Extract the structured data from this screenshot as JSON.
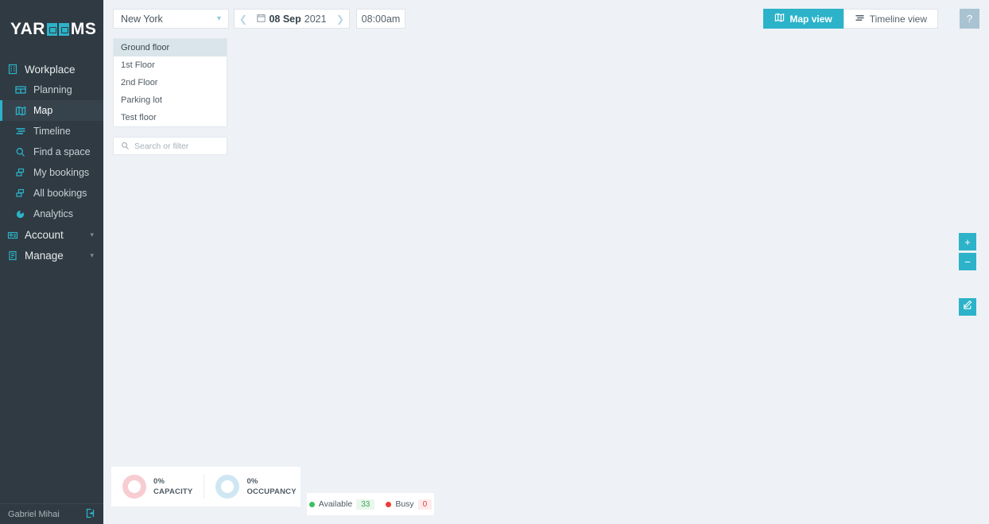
{
  "brand": {
    "name_part1": "YAR",
    "name_part2": "MS",
    "icon": "yarooms-logo"
  },
  "sidebar": {
    "groups": [
      {
        "label": "Workplace",
        "icon": "building-icon",
        "expandable": false,
        "items": [
          {
            "label": "Planning",
            "icon": "grid-icon",
            "active": false
          },
          {
            "label": "Map",
            "icon": "map-icon",
            "active": true
          },
          {
            "label": "Timeline",
            "icon": "timeline-icon",
            "active": false
          },
          {
            "label": "Find a space",
            "icon": "search-icon",
            "active": false
          },
          {
            "label": "My bookings",
            "icon": "bookings-icon",
            "active": false
          },
          {
            "label": "All bookings",
            "icon": "bookings-icon",
            "active": false
          },
          {
            "label": "Analytics",
            "icon": "pie-chart-icon",
            "active": false
          }
        ]
      },
      {
        "label": "Account",
        "icon": "account-icon",
        "expandable": true,
        "items": []
      },
      {
        "label": "Manage",
        "icon": "manage-icon",
        "expandable": true,
        "items": []
      }
    ],
    "user": {
      "name": "Gabriel Mihai",
      "logout_icon": "logout-icon"
    }
  },
  "toolbar": {
    "site": {
      "value": "New York",
      "chevron_icon": "chevron-down-icon"
    },
    "date": {
      "prev_icon": "chevron-left-icon",
      "next_icon": "chevron-right-icon",
      "calendar_icon": "calendar-icon",
      "day_month": "08 Sep",
      "year": "2021"
    },
    "time": {
      "value": "08:00am"
    },
    "views": [
      {
        "label": "Map view",
        "icon": "map-icon",
        "active": true
      },
      {
        "label": "Timeline view",
        "icon": "timeline-icon",
        "active": false
      }
    ],
    "help": {
      "label": "?",
      "icon": "help-icon"
    }
  },
  "floors": {
    "items": [
      {
        "label": "Ground floor",
        "selected": true
      },
      {
        "label": "1st Floor",
        "selected": false
      },
      {
        "label": "2nd Floor",
        "selected": false
      },
      {
        "label": "Parking lot",
        "selected": false
      },
      {
        "label": "Test floor",
        "selected": false
      }
    ]
  },
  "search": {
    "placeholder": "Search or filter",
    "icon": "search-icon"
  },
  "map_controls": {
    "zoom_in": {
      "label": "+",
      "icon": "plus-icon"
    },
    "zoom_out": {
      "label": "−",
      "icon": "minus-icon"
    },
    "edit": {
      "icon": "edit-pencil-icon"
    }
  },
  "stats": {
    "capacity": {
      "value": "0%",
      "label": "CAPACITY",
      "color": "#f7cdd2"
    },
    "occupancy": {
      "value": "0%",
      "label": "OCCUPANCY",
      "color": "#cfe7f2"
    }
  },
  "legend": {
    "available": {
      "label": "Available",
      "count": "33",
      "color": "#3fc063"
    },
    "busy": {
      "label": "Busy",
      "count": "0",
      "color": "#ef3b36"
    }
  }
}
